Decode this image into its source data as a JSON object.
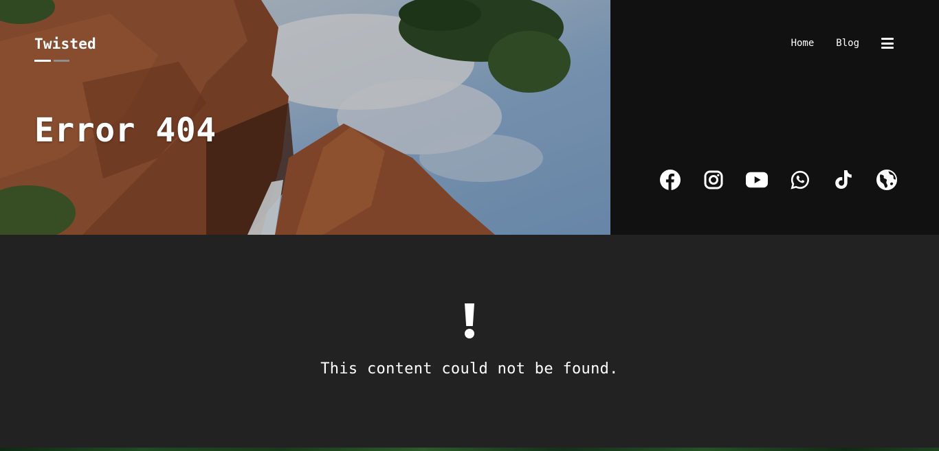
{
  "header": {
    "brand": "Twisted",
    "page_title": "Error 404",
    "nav": {
      "items": [
        {
          "label": "Home"
        },
        {
          "label": "Blog"
        }
      ],
      "menu_icon": "hamburger-menu-icon"
    },
    "socials": [
      {
        "icon": "facebook-icon"
      },
      {
        "icon": "instagram-icon"
      },
      {
        "icon": "youtube-icon"
      },
      {
        "icon": "whatsapp-icon"
      },
      {
        "icon": "tiktok-icon"
      },
      {
        "icon": "globe-icon"
      }
    ]
  },
  "main": {
    "icon": "exclamation-icon",
    "message": "This content could not be found."
  },
  "colors": {
    "side_panel": "#111111",
    "body_background": "#222222",
    "text": "#ffffff",
    "underline_secondary": "#8e8e8e"
  }
}
